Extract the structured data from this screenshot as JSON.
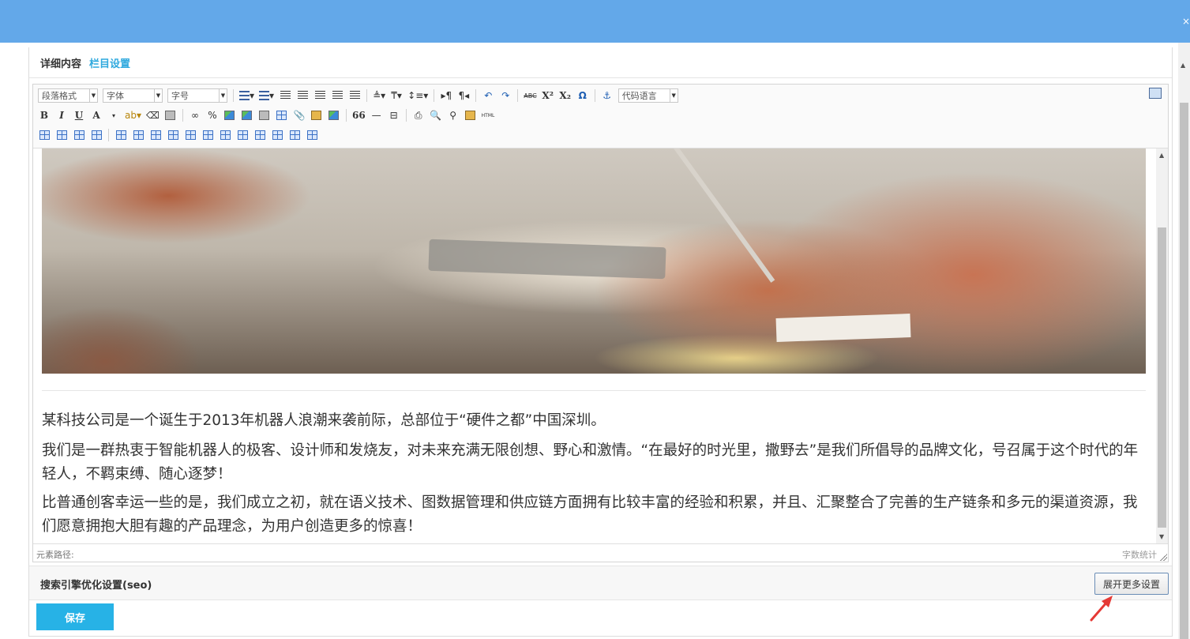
{
  "header": {
    "close_glyph": "×"
  },
  "panel": {
    "title": "详细内容",
    "title_link": "栏目设置"
  },
  "toolbar": {
    "paragraph_format": "段落格式",
    "font_family": "字体",
    "font_size": "字号",
    "code_language": "代码语言",
    "bold": "B",
    "italic": "I",
    "underline": "U",
    "font_color": "A",
    "superscript": "X²",
    "subscript": "X₂",
    "special_char": "Ω",
    "blockquote": "66",
    "horizontal_rule": "—",
    "strikethrough": "ABC",
    "html_source": "HTML"
  },
  "content": {
    "paragraphs": [
      "某科技公司是一个诞生于2013年机器人浪潮来袭前际，总部位于“硬件之都”中国深圳。",
      "我们是一群热衷于智能机器人的极客、设计师和发烧友，对未来充满无限创想、野心和激情。“在最好的时光里，撒野去”是我们所倡导的品牌文化，号召属于这个时代的年轻人，不羁束缚、随心逐梦！",
      "比普通创客幸运一些的是，我们成立之初，就在语义技术、图数据管理和供应链方面拥有比较丰富的经验和积累，并且、汇聚整合了完善的生产链条和多元的渠道资源，我们愿意拥抱大胆有趣的产品理念，为用户创造更多的惊喜！"
    ]
  },
  "statusbar": {
    "element_path": "元素路径:",
    "word_count": "字数统计"
  },
  "seo": {
    "label": "搜索引擎优化设置(seo)",
    "expand_button": "展开更多设置"
  },
  "actions": {
    "save": "保存"
  },
  "colors": {
    "header": "#63a8e9",
    "accent": "#2fa9de",
    "save_button": "#27b2e6",
    "annotation_arrow": "#e53935"
  }
}
